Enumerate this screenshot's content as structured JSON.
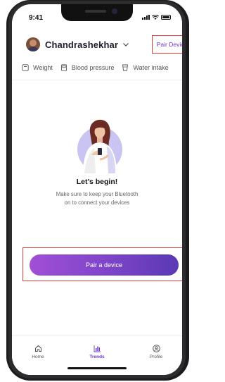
{
  "status": {
    "time": "9:41"
  },
  "header": {
    "username": "Chandrashekhar",
    "pair_device_label": "Pair Device"
  },
  "metrics": [
    {
      "label": "Weight",
      "icon": "scale-icon"
    },
    {
      "label": "Blood pressure",
      "icon": "bp-monitor-icon"
    },
    {
      "label": "Water intake",
      "icon": "water-glass-icon"
    }
  ],
  "empty_state": {
    "title": "Let’s begin!",
    "line1": "Make sure to keep your Bluetooth",
    "line2": "on to connect your devices"
  },
  "cta": {
    "label": "Pair a device"
  },
  "nav": {
    "items": [
      {
        "label": "Home",
        "icon": "home-icon",
        "active": false
      },
      {
        "label": "Trends",
        "icon": "bar-chart-icon",
        "active": true
      },
      {
        "label": "Profile",
        "icon": "profile-icon",
        "active": false
      }
    ]
  },
  "colors": {
    "accent": "#6a34c8",
    "gradient_start": "#a14fd6",
    "gradient_end": "#5a39b3",
    "highlight_border": "#e23b3b"
  }
}
